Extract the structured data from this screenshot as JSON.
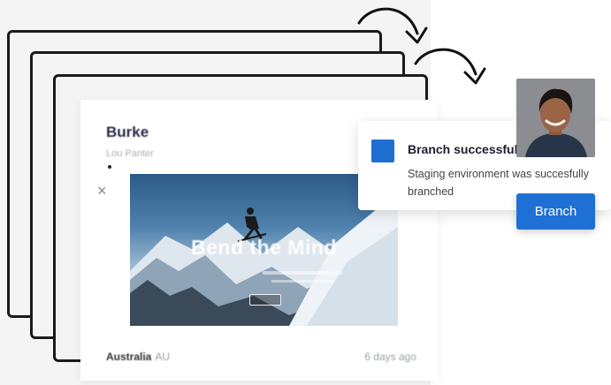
{
  "card": {
    "title": "Burke",
    "subtitle": "Lou Panter",
    "close_glyph": "×",
    "hero": {
      "title": "Bend the Mind"
    },
    "footer": {
      "country": "Australia",
      "country_code": "AU",
      "time_ago": "6 days ago"
    }
  },
  "toast": {
    "title": "Branch successful",
    "message": "Staging environment was succesfully branched",
    "accent_color": "#1f6fd1"
  },
  "action": {
    "branch_label": "Branch"
  },
  "colors": {
    "primary": "#1f70d4",
    "stack_border": "#1a1a1a",
    "panel_bg": "#f4f4f4"
  },
  "icons": [
    "arrow-icon",
    "close-icon",
    "avatar"
  ]
}
